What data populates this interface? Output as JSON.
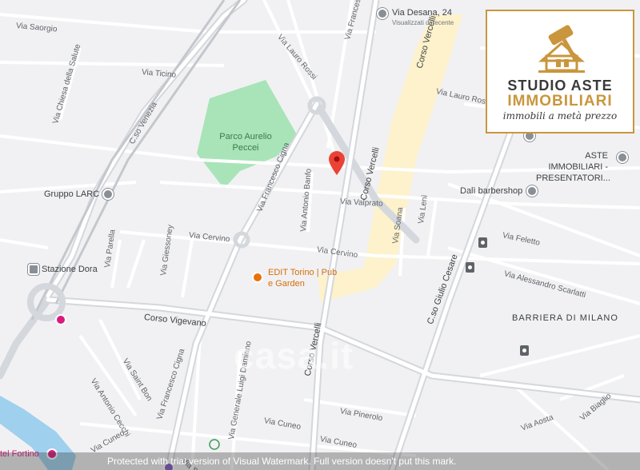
{
  "map": {
    "streets": [
      "Via Saorgio",
      "Via Chiesa della Salute",
      "Via Ticino",
      "C.so Venezia",
      "Via Lauro Rossi",
      "Via Francesco Cigna",
      "Via Antonio Banfo",
      "Via Valprato",
      "Via Cervino",
      "Via Cervino",
      "Via Parella",
      "Via Giessoney",
      "Corso Vigevano",
      "Via Saint Bon",
      "Via Antonio Cecchi",
      "Via Cuneo",
      "Via Francesco Cigna",
      "Via Generale Luigi Damiano",
      "Via Cuneo",
      "Via Pinerolo",
      "Via Cuneo",
      "Corso Vercelli",
      "Corso Vercelli",
      "Via Soana",
      "Via Lenì",
      "C.so Giulio Cesare",
      "Via Feletto",
      "Via Alessandro Scarlatti",
      "Via Aosta",
      "Via Biaglio",
      "Via Lauro Rossi",
      "Corso Vercelli",
      "Via Francesco",
      "Via Saint B"
    ],
    "parks": [
      "Parco Aurelio Peccei"
    ],
    "area_label": "BARRIERA DI MILANO",
    "places": {
      "via_desana": "Via Desana, 24",
      "via_desana_sub": "Visualizzati di recente",
      "aste": "ASTE IMMOBILIARI - PRESENTATORI...",
      "dali": "Dalì barbershop",
      "gruppo": "Gruppo LARC",
      "stazione": "Stazione Dora",
      "edit": "EDIT Torino | Pub e Garden",
      "fortino": "tel Fortino"
    },
    "marker": "location-pin"
  },
  "brand": {
    "line1": "STUDIO ASTE",
    "line2": "IMMOBILIARI",
    "line3": "immobili a metà prezzo",
    "colors": {
      "gold": "#c9963d",
      "dark": "#3a3a3a"
    }
  },
  "watermarks": {
    "casa": "casa.it",
    "protected": "Protected with trial version of Visual Watermark. Full version doesn't put this mark."
  },
  "colors": {
    "background": "#f1f1f3",
    "road": "#ffffff",
    "main_road": "#cfd3d8",
    "park": "#a8e4b8",
    "river": "#9fd0ee",
    "highlight": "#fdf2cc",
    "pin": "#ea4335"
  }
}
